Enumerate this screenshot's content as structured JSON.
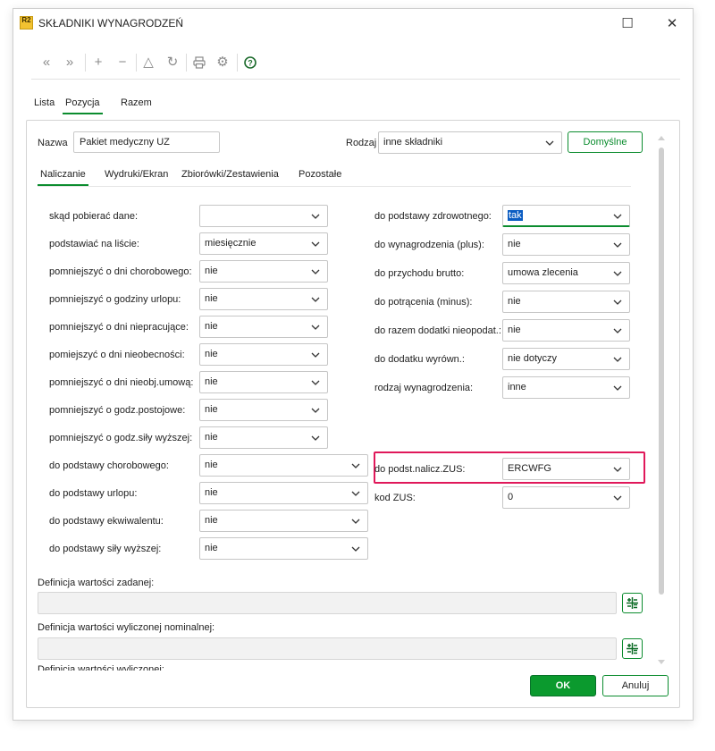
{
  "window": {
    "title": "SKŁADNIKI WYNAGRODZEŃ",
    "app_icon_text": "R2",
    "maximize_glyph": "☐",
    "close_glyph": "✕"
  },
  "toolbar": {
    "items": [
      {
        "name": "first-icon",
        "glyph": "«"
      },
      {
        "name": "last-icon",
        "glyph": "»"
      },
      {
        "name": "add-icon",
        "glyph": "+"
      },
      {
        "name": "remove-icon",
        "glyph": "−"
      },
      {
        "name": "warning-icon",
        "glyph": "△"
      },
      {
        "name": "refresh-icon",
        "glyph": "↻"
      },
      {
        "name": "print-icon",
        "glyph": "⎙"
      },
      {
        "name": "settings-icon",
        "glyph": "⚙"
      },
      {
        "name": "help-icon",
        "glyph": "?"
      }
    ]
  },
  "main_tabs": [
    {
      "label": "Lista",
      "active": false
    },
    {
      "label": "Pozycja",
      "active": true
    },
    {
      "label": "Razem",
      "active": false
    }
  ],
  "header": {
    "name_label": "Nazwa",
    "name_value": "Pakiet medyczny UZ",
    "type_label": "Rodzaj",
    "type_value": "inne składniki",
    "defaults_button": "Domyślne"
  },
  "sub_tabs": [
    {
      "label": "Naliczanie",
      "active": true
    },
    {
      "label": "Wydruki/Ekran",
      "active": false
    },
    {
      "label": "Zbiorówki/Zestawienia",
      "active": false
    },
    {
      "label": "Pozostałe",
      "active": false
    }
  ],
  "left_fields": [
    {
      "label": "skąd pobierać dane:",
      "value": ""
    },
    {
      "label": "podstawiać na liście:",
      "value": "miesięcznie"
    },
    {
      "label": "pomniejszyć o dni chorobowego:",
      "value": "nie"
    },
    {
      "label": "pomniejszyć o godziny urlopu:",
      "value": "nie"
    },
    {
      "label": "pomniejszyć o dni niepracujące:",
      "value": "nie"
    },
    {
      "label": "pomiejszyć o dni nieobecności:",
      "value": "nie"
    },
    {
      "label": "pomniejszyć o dni nieobj.umową:",
      "value": "nie"
    },
    {
      "label": "pomniejszyć o godz.postojowe:",
      "value": "nie"
    },
    {
      "label": "pomniejszyć o godz.siły wyższej:",
      "value": "nie"
    },
    {
      "label": "do podstawy chorobowego:",
      "value": "nie"
    },
    {
      "label": "do podstawy urlopu:",
      "value": "nie"
    },
    {
      "label": "do podstawy ekwiwalentu:",
      "value": "nie"
    },
    {
      "label": "do podstawy siły wyższej:",
      "value": "nie"
    }
  ],
  "right_fields": [
    {
      "label": "do podstawy zdrowotnego:",
      "value": "tak",
      "focused": true
    },
    {
      "label": "do wynagrodzenia (plus):",
      "value": "nie"
    },
    {
      "label": "do przychodu brutto:",
      "value": "umowa zlecenia"
    },
    {
      "label": "do potrącenia (minus):",
      "value": "nie"
    },
    {
      "label": "do razem dodatki nieopodat.:",
      "value": "nie"
    },
    {
      "label": "do dodatku wyrówn.:",
      "value": "nie dotyczy"
    },
    {
      "label": "rodzaj wynagrodzenia:",
      "value": "inne"
    }
  ],
  "zus_fields": [
    {
      "label": "do podst.nalicz.ZUS:",
      "value": "ERCWFG",
      "highlighted": true
    },
    {
      "label": "kod ZUS:",
      "value": "0"
    }
  ],
  "definitions": [
    {
      "label": "Definicja wartości zadanej:"
    },
    {
      "label": "Definicja wartości wyliczonej nominalnej:"
    },
    {
      "label": "Definicja wartości wyliczonej:"
    }
  ],
  "footer": {
    "ok": "OK",
    "cancel": "Anuluj"
  },
  "colors": {
    "accent": "#0b8c2e",
    "highlight_box": "#e0185a",
    "selection": "#0a5cc2"
  }
}
